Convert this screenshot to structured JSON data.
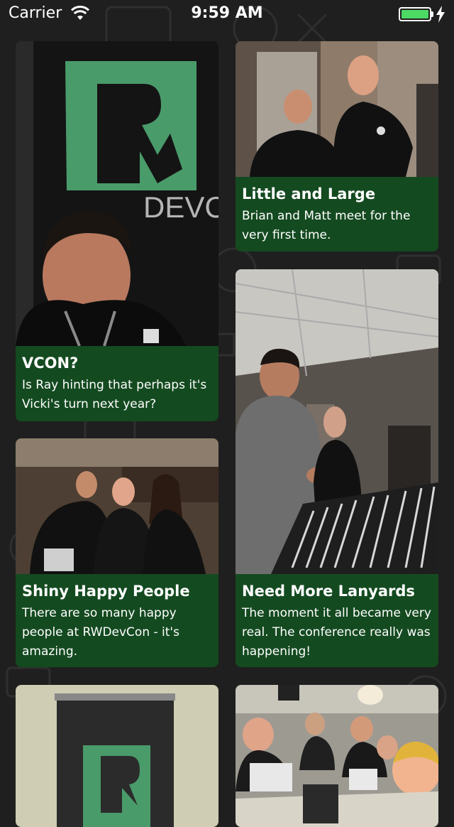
{
  "status_bar": {
    "carrier": "Carrier",
    "time": "9:59 AM",
    "battery_level": 1.0,
    "wifi_icon": "wifi-icon",
    "charging_icon": "bolt-icon"
  },
  "colors": {
    "background": "#1f1f1f",
    "caption_background": "#144a20",
    "brand_green": "#4a9b6a",
    "battery_green": "#4cd964"
  },
  "cards": [
    {
      "title": "VCON?",
      "description": "Is Ray hinting that perhaps it's Vicki's turn next year?"
    },
    {
      "title": "Little and Large",
      "description": "Brian and Matt meet for the very first time."
    },
    {
      "title": "Need More Lanyards",
      "description": "The moment it all became very real. The conference really was happening!"
    },
    {
      "title": "Shiny Happy People",
      "description": "There are so many happy people at RWDevCon - it's amazing."
    },
    {
      "title": "",
      "description": ""
    },
    {
      "title": "",
      "description": ""
    }
  ],
  "banner_text": "DEVCON"
}
